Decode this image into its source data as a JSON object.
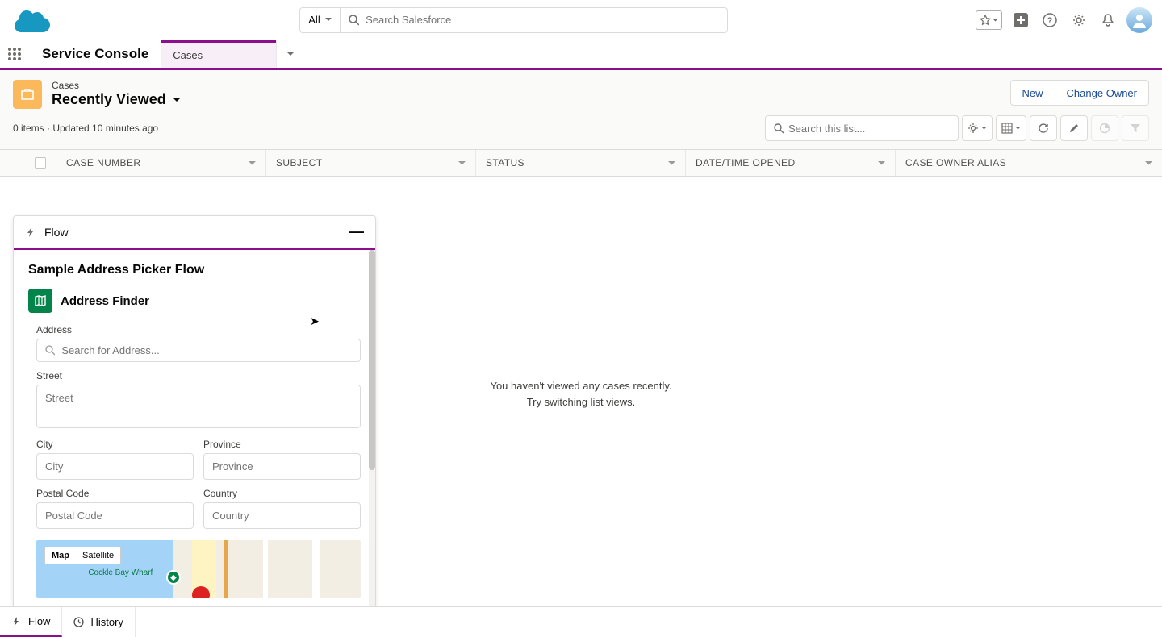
{
  "topbar": {
    "search_scope": "All",
    "search_placeholder": "Search Salesforce"
  },
  "navbar": {
    "app_name": "Service Console",
    "tab": "Cases"
  },
  "header": {
    "object": "Cases",
    "list_view": "Recently Viewed",
    "new_btn": "New",
    "change_owner_btn": "Change Owner"
  },
  "subheader": {
    "meta": "0 items · Updated 10 minutes ago",
    "search_placeholder": "Search this list..."
  },
  "columns": {
    "c0": "CASE NUMBER",
    "c1": "SUBJECT",
    "c2": "STATUS",
    "c3": "DATE/TIME OPENED",
    "c4": "CASE OWNER ALIAS"
  },
  "empty": {
    "line1": "You haven't viewed any cases recently.",
    "line2": "Try switching list views."
  },
  "flow": {
    "panel_label": "Flow",
    "title": "Sample Address Picker Flow",
    "section_title": "Address Finder",
    "address_label": "Address",
    "address_placeholder": "Search for Address...",
    "street_label": "Street",
    "street_placeholder": "Street",
    "city_label": "City",
    "city_placeholder": "City",
    "province_label": "Province",
    "province_placeholder": "Province",
    "postal_label": "Postal Code",
    "postal_placeholder": "Postal Code",
    "country_label": "Country",
    "country_placeholder": "Country",
    "map_tab_map": "Map",
    "map_tab_sat": "Satellite",
    "map_feature": "Cockle Bay Wharf"
  },
  "utility": {
    "flow": "Flow",
    "history": "History"
  }
}
